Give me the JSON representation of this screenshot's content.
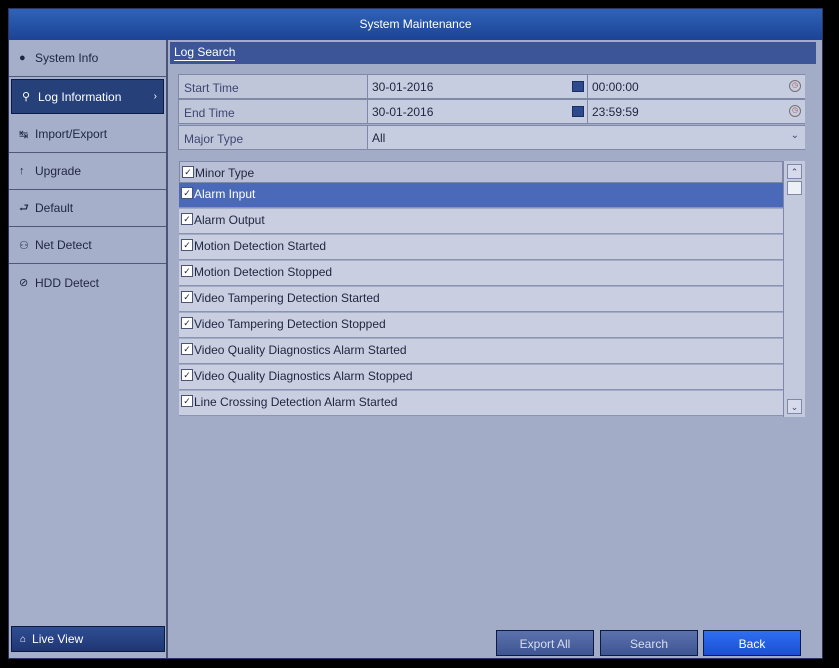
{
  "window": {
    "title": "System Maintenance"
  },
  "sidebar": {
    "items": [
      {
        "label": "System Info",
        "icon": "info-icon",
        "glyph": "●"
      },
      {
        "label": "Log Information",
        "icon": "search-icon",
        "glyph": "⚲"
      },
      {
        "label": "Import/Export",
        "icon": "transfer-icon",
        "glyph": "↹"
      },
      {
        "label": "Upgrade",
        "icon": "upgrade-icon",
        "glyph": "↑"
      },
      {
        "label": "Default",
        "icon": "reset-icon",
        "glyph": "⮐"
      },
      {
        "label": "Net Detect",
        "icon": "network-icon",
        "glyph": "⚇"
      },
      {
        "label": "HDD Detect",
        "icon": "hdd-icon",
        "glyph": "⊘"
      }
    ],
    "active_index": 1,
    "live_view_label": "Live View"
  },
  "tab": {
    "label": "Log Search"
  },
  "form": {
    "start_time": {
      "label": "Start Time",
      "date": "30-01-2016",
      "time": "00:00:00"
    },
    "end_time": {
      "label": "End Time",
      "date": "30-01-2016",
      "time": "23:59:59"
    },
    "major_type": {
      "label": "Major Type",
      "value": "All"
    }
  },
  "minor_type": {
    "header": "Minor Type",
    "items": [
      "Alarm Input",
      "Alarm Output",
      "Motion Detection Started",
      "Motion Detection Stopped",
      "Video Tampering Detection Started",
      "Video Tampering Detection Stopped",
      "Video Quality Diagnostics Alarm Started",
      "Video Quality Diagnostics Alarm Stopped",
      "Line Crossing Detection Alarm Started"
    ],
    "selected_index": 0
  },
  "buttons": {
    "export_all": "Export All",
    "search": "Search",
    "back": "Back"
  },
  "colors": {
    "titlebar": "#1c4395",
    "active": "#26407a",
    "selected_row": "#4a69b8",
    "back_button": "#1b4fd6"
  }
}
